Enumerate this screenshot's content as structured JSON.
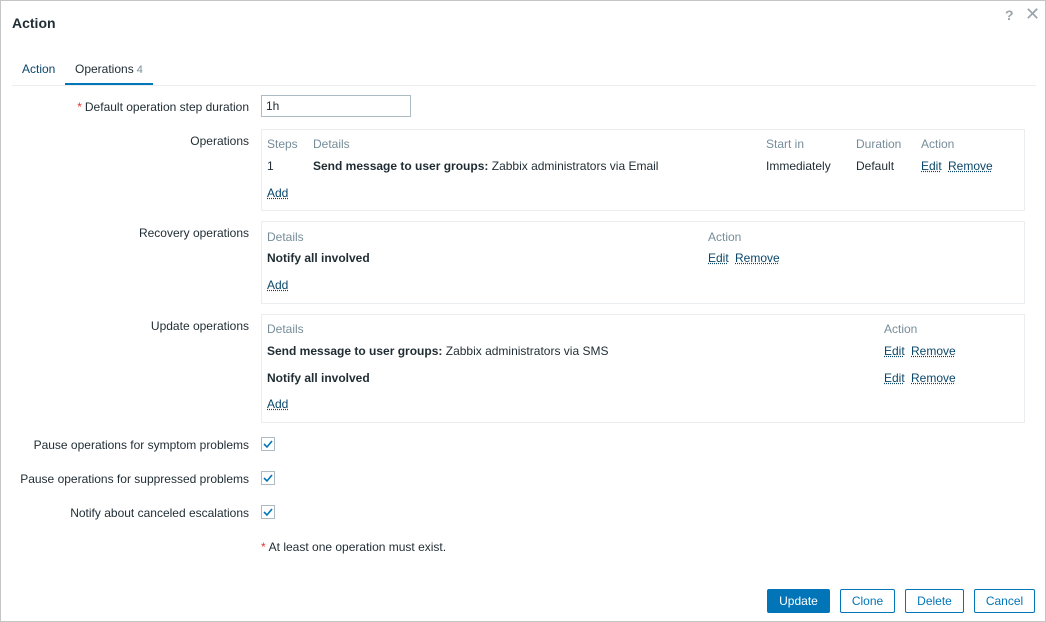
{
  "dialog": {
    "title": "Action",
    "help_icon": "?",
    "close_icon": "✕"
  },
  "tabs": [
    {
      "label": "Action"
    },
    {
      "label": "Operations",
      "count": "4"
    }
  ],
  "form": {
    "step_duration": {
      "label": "Default operation step duration",
      "value": "1h"
    },
    "operations": {
      "label": "Operations",
      "headers": [
        "Steps",
        "Details",
        "Start in",
        "Duration",
        "Action"
      ],
      "rows": [
        {
          "steps": "1",
          "details_bold": "Send message to user groups:",
          "details_rest": "Zabbix administrators via Email",
          "start_in": "Immediately",
          "duration": "Default",
          "edit": "Edit",
          "remove": "Remove"
        }
      ],
      "add": "Add"
    },
    "recovery_operations": {
      "label": "Recovery operations",
      "headers": [
        "Details",
        "Action"
      ],
      "rows": [
        {
          "details_bold": "Notify all involved",
          "edit": "Edit",
          "remove": "Remove"
        }
      ],
      "add": "Add"
    },
    "update_operations": {
      "label": "Update operations",
      "headers": [
        "Details",
        "Action"
      ],
      "rows": [
        {
          "details_bold": "Send message to user groups:",
          "details_rest": "Zabbix administrators via SMS",
          "edit": "Edit",
          "remove": "Remove"
        },
        {
          "details_bold": "Notify all involved",
          "edit": "Edit",
          "remove": "Remove"
        }
      ],
      "add": "Add"
    },
    "pause_symptom": {
      "label": "Pause operations for symptom problems",
      "checked": true
    },
    "pause_suppressed": {
      "label": "Pause operations for suppressed problems",
      "checked": true
    },
    "notify_canceled": {
      "label": "Notify about canceled escalations",
      "checked": true
    },
    "note": "At least one operation must exist."
  },
  "footer": {
    "update": "Update",
    "clone": "Clone",
    "delete": "Delete",
    "cancel": "Cancel"
  },
  "colors": {
    "primary": "#0275b8",
    "link": "#0a466a",
    "required": "#e33734"
  }
}
